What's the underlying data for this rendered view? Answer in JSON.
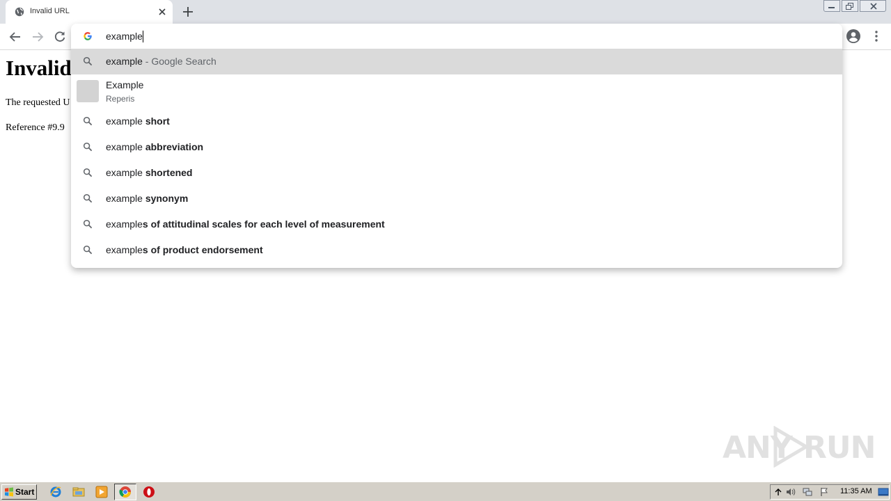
{
  "tab": {
    "title": "Invalid URL",
    "favicon_icon": "globe-icon",
    "close_icon": "close-icon"
  },
  "new_tab_icon": "plus-icon",
  "window_controls": [
    "minimize-icon",
    "restore-icon",
    "close-icon"
  ],
  "toolbar": {
    "back_icon": "arrow-left-icon",
    "forward_icon": "arrow-right-icon",
    "reload_icon": "reload-icon",
    "profile_icon": "account-circle-icon",
    "menu_icon": "kebab-menu-icon"
  },
  "omnibox": {
    "value": "example",
    "engine_icon": "google-g-icon",
    "suggestions": [
      {
        "type": "search",
        "icon": "search-icon",
        "prefix": "example",
        "bold": "",
        "desc": " - Google Search",
        "selected": true
      },
      {
        "type": "bookmark",
        "title": "Example",
        "subtitle": "Reperis"
      },
      {
        "type": "search",
        "icon": "search-icon",
        "prefix": "example ",
        "bold": "short"
      },
      {
        "type": "search",
        "icon": "search-icon",
        "prefix": "example ",
        "bold": "abbreviation"
      },
      {
        "type": "search",
        "icon": "search-icon",
        "prefix": "example ",
        "bold": "shortened"
      },
      {
        "type": "search",
        "icon": "search-icon",
        "prefix": "example ",
        "bold": "synonym"
      },
      {
        "type": "search",
        "icon": "search-icon",
        "prefix": "example",
        "bold": "s of attitudinal scales for each level of measurement"
      },
      {
        "type": "search",
        "icon": "search-icon",
        "prefix": "example",
        "bold": "s of product endorsement"
      }
    ]
  },
  "page": {
    "heading": "Invalid",
    "line1": "The requested U",
    "line2": "Reference #9.9"
  },
  "watermark": {
    "left": "ANY",
    "right": "RUN"
  },
  "taskbar": {
    "start_label": "Start",
    "apps": [
      "internet-explorer-icon",
      "file-explorer-icon",
      "media-player-icon",
      "chrome-icon",
      "opera-icon"
    ],
    "tray_icons": [
      "show-hidden-icons-icon",
      "volume-icon",
      "network-icon",
      "action-center-flag-icon",
      "show-desktop-icon"
    ],
    "clock": "11:35 AM"
  }
}
